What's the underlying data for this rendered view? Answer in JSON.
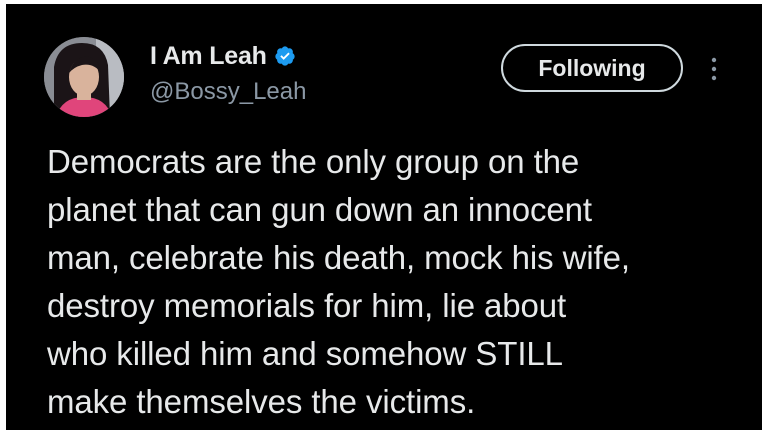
{
  "author": {
    "display_name": "I Am Leah",
    "handle": "@Bossy_Leah",
    "verified": true
  },
  "follow_button": {
    "label": "Following"
  },
  "more_menu": {
    "icon": "more-vertical-icon"
  },
  "tweet": {
    "lines": [
      "Democrats are the only group on the",
      "planet that can gun down an innocent",
      "man, celebrate his death, mock his wife,",
      "destroy memorials for him, lie about",
      "who killed him and somehow STILL",
      "make themselves the victims."
    ]
  },
  "colors": {
    "background": "#000000",
    "text_primary": "#e7e9ea",
    "text_secondary": "#8b98a5",
    "verified_blue": "#1d9bf0",
    "button_border": "#cfd9de"
  }
}
